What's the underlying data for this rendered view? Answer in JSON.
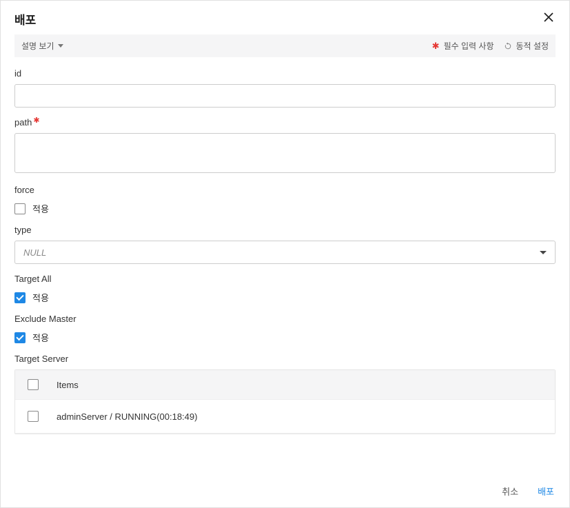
{
  "dialog": {
    "title": "배포"
  },
  "toolbar": {
    "desc_toggle": "설명 보기",
    "required_legend": "필수 입력 사항",
    "dynamic_legend": "동적 설정"
  },
  "fields": {
    "id": {
      "label": "id",
      "value": ""
    },
    "path": {
      "label": "path",
      "required": true,
      "value": ""
    },
    "force": {
      "label": "force",
      "checkbox_label": "적용",
      "checked": false
    },
    "type": {
      "label": "type",
      "value": "NULL"
    },
    "target_all": {
      "label": "Target All",
      "checkbox_label": "적용",
      "checked": true
    },
    "exclude_master": {
      "label": "Exclude Master",
      "checkbox_label": "적용",
      "checked": true
    },
    "target_server": {
      "label": "Target Server"
    }
  },
  "table": {
    "header": "Items",
    "rows": [
      {
        "label": "adminServer / RUNNING(00:18:49)",
        "checked": false
      }
    ]
  },
  "footer": {
    "cancel": "취소",
    "submit": "배포"
  }
}
